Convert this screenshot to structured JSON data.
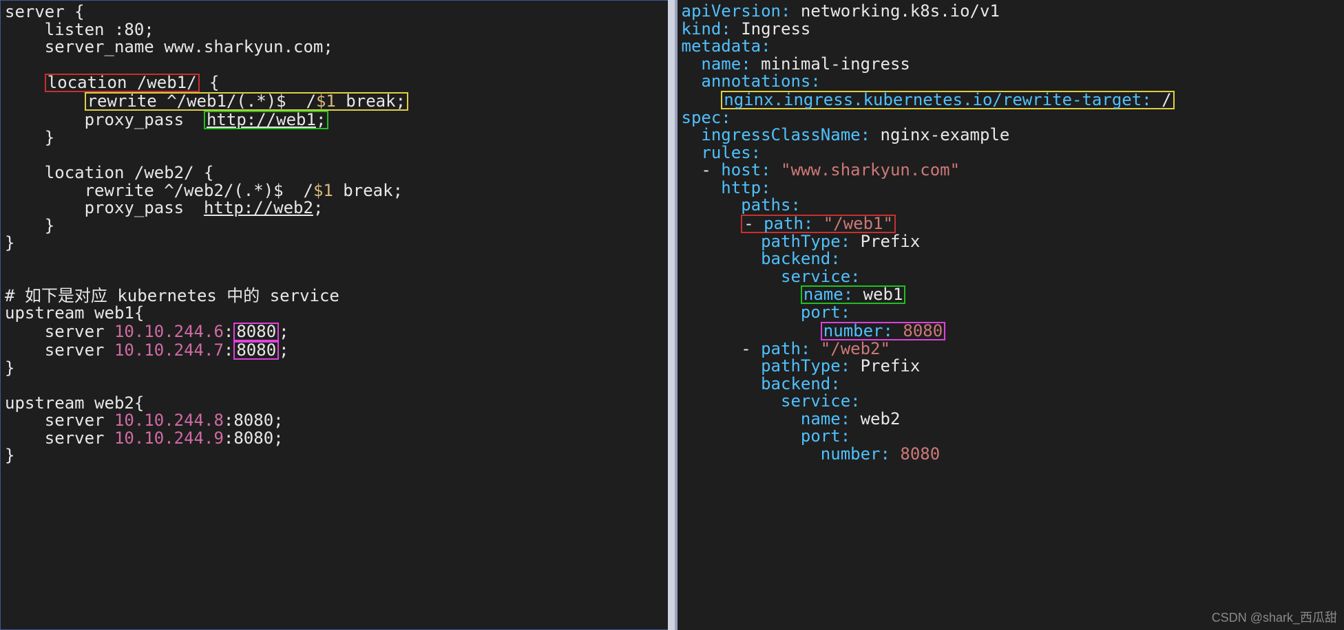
{
  "left": {
    "server_line": "server {",
    "listen": "    listen :80;",
    "sn_key": "    server_name ",
    "sn_val": "www.sharkyun.com",
    "sn_tail": ";",
    "loc1_key": "location ",
    "loc1_path": "/web1/",
    "loc1_brace": " {",
    "rw1_a": "rewrite ^",
    "rw1_b": "/web1/",
    "rw1_c": "(.",
    "rw1_d": "*",
    "rw1_e": ")$  /",
    "rw1_f": "$1",
    "rw1_g": " break",
    "rw1_h": ";",
    "pp1_k": "        proxy_pass  ",
    "pp1_v": "http://web1",
    "pp1_t": ";",
    "loc2_key": "    location ",
    "loc2_path": "/web2/",
    "loc2_brace": " {",
    "rw2_a": "        rewrite ^",
    "rw2_b": "/web2/",
    "rw2_c": "(.",
    "rw2_d": "*",
    "rw2_e": ")$  /",
    "rw2_f": "$1",
    "rw2_g": " break",
    "rw2_h": ";",
    "pp2_k": "        proxy_pass  ",
    "pp2_v": "http://web2",
    "pp2_t": ";",
    "comment": "# 如下是对应 kubernetes 中的 service",
    "up1": "upstream web1{",
    "up1s1a": "    server ",
    "up1s1b": "10.10.244.6",
    "up1s1c": ":",
    "up1s1d": "8080",
    "up1s1e": ";",
    "up1s2a": "    server ",
    "up1s2b": "10.10.244.7",
    "up1s2c": ":",
    "up1s2d": "8080",
    "up1s2e": ";",
    "up2": "upstream web2{",
    "up2s1a": "    server ",
    "up2s1b": "10.10.244.8",
    "up2s1c": ":",
    "up2s1d": "8080",
    "up2s1e": ";",
    "up2s2a": "    server ",
    "up2s2b": "10.10.244.9",
    "up2s2c": ":",
    "up2s2d": "8080",
    "up2s2e": ";",
    "cb": "}",
    "ccb": "    }"
  },
  "right": {
    "l01a": "apiVersion:",
    "l01b": " networking.k8s.io/v1",
    "l02a": "kind:",
    "l02b": " Ingress",
    "l03": "metadata:",
    "l04a": "  name:",
    "l04b": " minimal-ingress",
    "l05": "  annotations:",
    "l06a": "nginx.ingress.kubernetes.io/rewrite-target:",
    "l06b": " /",
    "l07": "spec:",
    "l08a": "  ingressClassName:",
    "l08b": " nginx-example",
    "l09": "  rules:",
    "l10a": "  - ",
    "l10b": "host:",
    "l10c": " \"www.sharkyun.com\"",
    "l11": "    http:",
    "l12": "      paths:",
    "l13a": "- ",
    "l13b": "path:",
    "l13c": " \"/web1\"",
    "l14a": "        pathType:",
    "l14b": " Prefix",
    "l15": "        backend:",
    "l16": "          service:",
    "l17a": "name:",
    "l17b": " web1",
    "l18": "            port:",
    "l19a": "number:",
    "l19b": " 8080",
    "l20a": "      - ",
    "l20b": "path:",
    "l20c": " \"/web2\"",
    "l21a": "        pathType:",
    "l21b": " Prefix",
    "l22": "        backend:",
    "l23": "          service:",
    "l24a": "            name:",
    "l24b": " web2",
    "l25": "            port:",
    "l26a": "              number:",
    "l26b": " 8080"
  },
  "watermark": "CSDN @shark_西瓜甜"
}
